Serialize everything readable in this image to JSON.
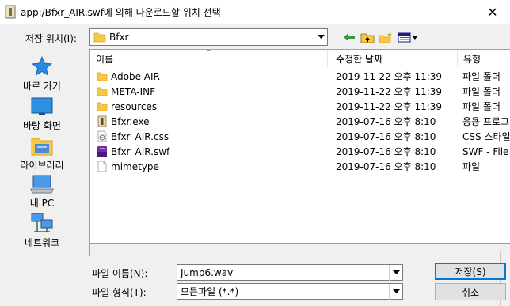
{
  "window": {
    "title": "app:/Bfxr_AIR.swf에 의해 다운로드할 위치 선택",
    "close_glyph": "✕"
  },
  "lookin": {
    "label": "저장 위치(I):",
    "value": "Bfxr"
  },
  "places": [
    {
      "label": "바로 가기",
      "icon": "star-icon"
    },
    {
      "label": "바탕 화면",
      "icon": "desktop-icon"
    },
    {
      "label": "라이브러리",
      "icon": "library-icon"
    },
    {
      "label": "내 PC",
      "icon": "computer-icon"
    },
    {
      "label": "네트워크",
      "icon": "network-icon"
    }
  ],
  "columns": {
    "name": "이름",
    "date": "수정한 날짜",
    "type": "유형"
  },
  "files": [
    {
      "name": "Adobe AIR",
      "date": "2019-11-22 오후 11:39",
      "type": "파일 폴더",
      "icon": "folder-icon"
    },
    {
      "name": "META-INF",
      "date": "2019-11-22 오후 11:39",
      "type": "파일 폴더",
      "icon": "folder-icon"
    },
    {
      "name": "resources",
      "date": "2019-11-22 오후 11:39",
      "type": "파일 폴더",
      "icon": "folder-icon"
    },
    {
      "name": "Bfxr.exe",
      "date": "2019-07-16 오후 8:10",
      "type": "응용 프로그램",
      "icon": "exe-icon"
    },
    {
      "name": "Bfxr_AIR.css",
      "date": "2019-07-16 오후 8:10",
      "type": "CSS 스타일",
      "icon": "css-icon"
    },
    {
      "name": "Bfxr_AIR.swf",
      "date": "2019-07-16 오후 8:10",
      "type": "SWF - File",
      "icon": "swf-icon"
    },
    {
      "name": "mimetype",
      "date": "2019-07-16 오후 8:10",
      "type": "파일",
      "icon": "file-icon"
    }
  ],
  "filename": {
    "label": "파일 이름(N):",
    "value": "Jump6.wav"
  },
  "filetype": {
    "label": "파일 형식(T):",
    "value": "모든파일 (*.*)"
  },
  "buttons": {
    "save": "저장(S)",
    "cancel": "취소"
  },
  "colors": {
    "folder": "#f7c846",
    "accent": "#0078d7",
    "star": "#2a8ae0"
  }
}
